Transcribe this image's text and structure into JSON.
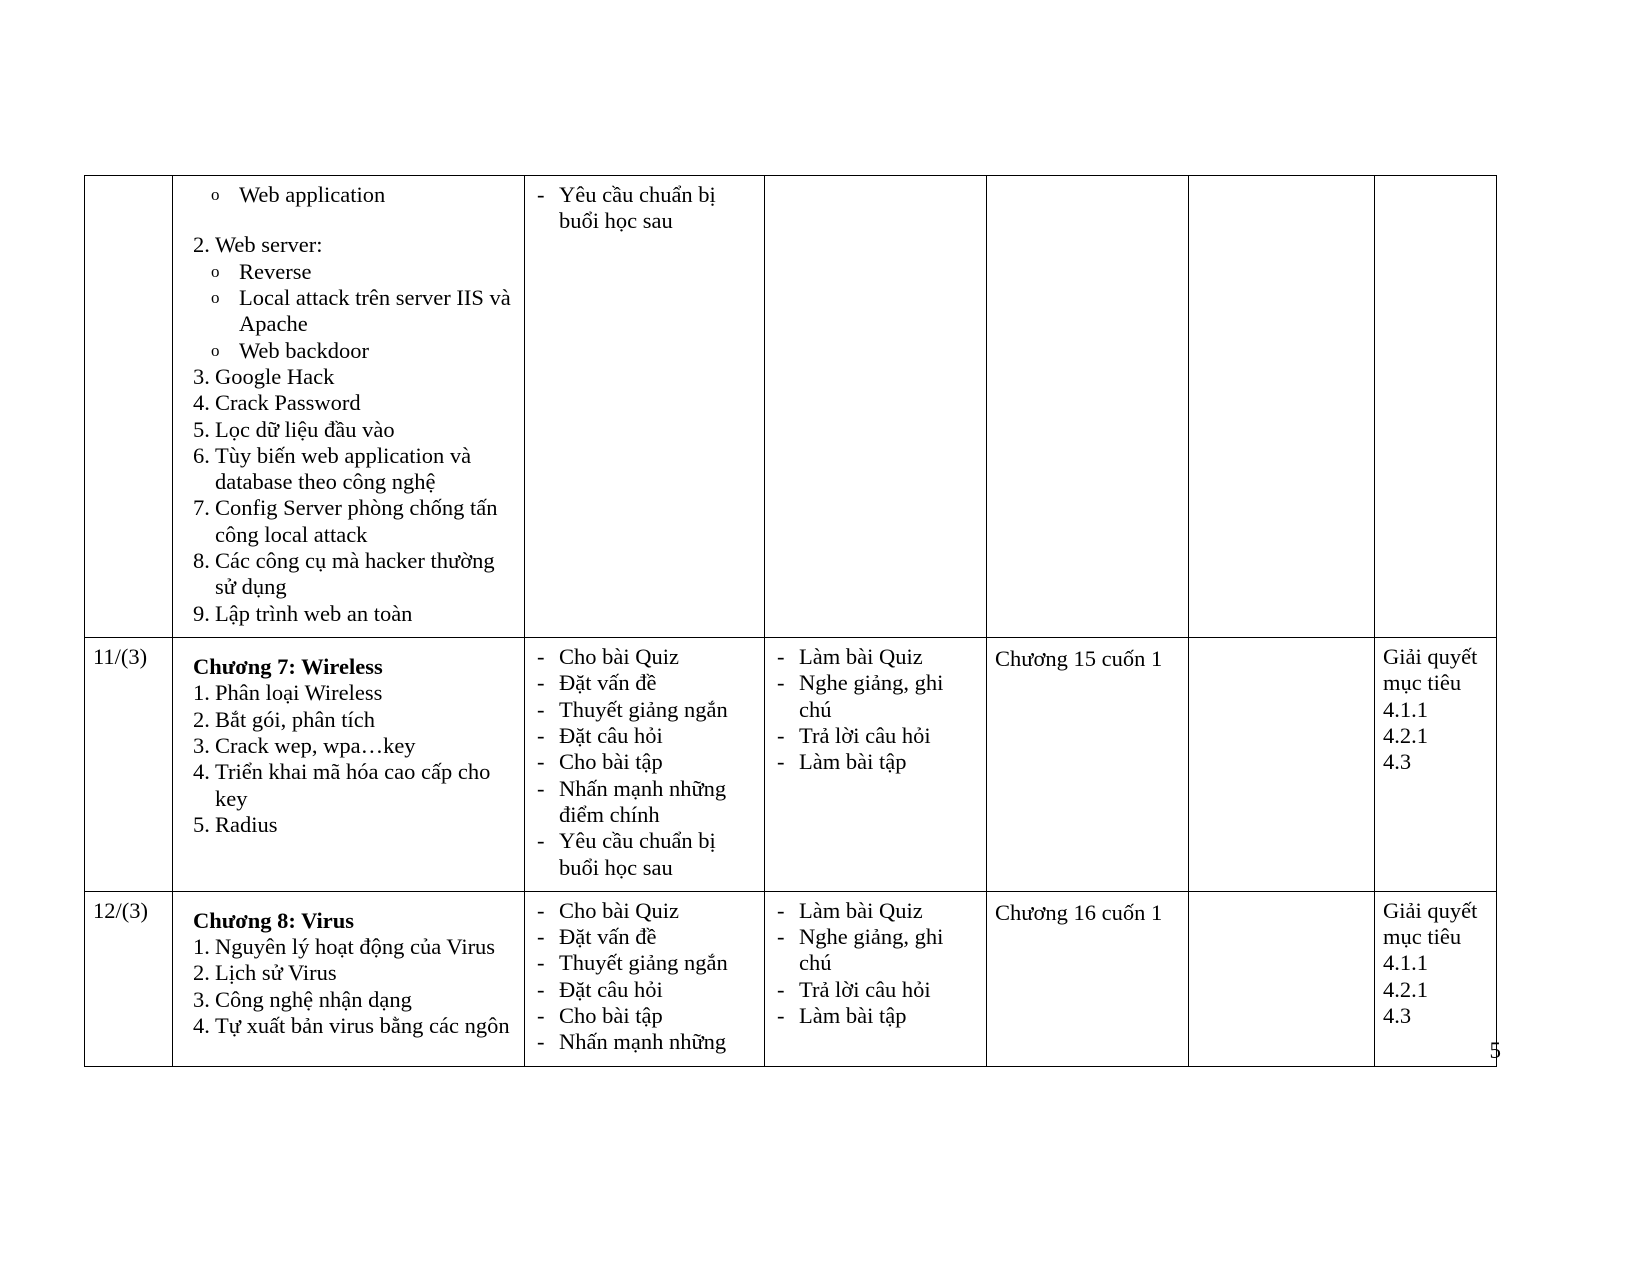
{
  "document": {
    "page_number": "5"
  },
  "table": {
    "rows": [
      {
        "week": "",
        "content": {
          "sub_items_top": [
            "Web application"
          ],
          "section2_label": "2.",
          "section2_title": "Web server:",
          "section2_subitems": [
            "Reverse",
            "Local attack trên server IIS và Apache",
            "Web backdoor"
          ],
          "numbered": [
            {
              "n": "3.",
              "text": "Google Hack"
            },
            {
              "n": "4.",
              "text": "Crack Password"
            },
            {
              "n": "5.",
              "text": "Lọc dữ liệu đầu vào"
            },
            {
              "n": "6.",
              "text": "Tùy biến web application và database theo công nghệ"
            },
            {
              "n": "7.",
              "text": "Config Server phòng chống tấn công local attack"
            },
            {
              "n": "8.",
              "text": "Các công cụ mà hacker thường sử dụng"
            },
            {
              "n": "9.",
              "text": "Lập trình web an toàn"
            }
          ]
        },
        "teaching": [
          "Yêu cầu chuẩn bị buổi học sau"
        ],
        "learning": [],
        "reference": "",
        "extra": "",
        "goal": []
      },
      {
        "week": "11/(3)",
        "content": {
          "chapter": "Chương 7: Wireless",
          "numbered": [
            {
              "n": "1.",
              "text": "Phân loại Wireless"
            },
            {
              "n": "2.",
              "text": "Bắt gói, phân tích"
            },
            {
              "n": "3.",
              "text": "Crack wep, wpa…key"
            },
            {
              "n": "4.",
              "text": "Triển khai mã hóa cao cấp cho key"
            },
            {
              "n": "5.",
              "text": "Radius"
            }
          ]
        },
        "teaching": [
          "Cho bài Quiz",
          "Đặt vấn đề",
          "Thuyết giảng ngắn",
          "Đặt câu hỏi",
          "Cho bài tập",
          "Nhấn mạnh những điểm chính",
          "Yêu cầu chuẩn bị buổi học sau"
        ],
        "learning": [
          "Làm bài Quiz",
          "Nghe giảng, ghi chú",
          "Trả lời câu hỏi",
          "Làm bài tập"
        ],
        "reference": "Chương 15 cuốn 1",
        "extra": "",
        "goal": [
          "Giải quyết",
          "mục tiêu",
          "4.1.1",
          "4.2.1",
          "4.3"
        ]
      },
      {
        "week": "12/(3)",
        "content": {
          "chapter": "Chương 8: Virus",
          "numbered": [
            {
              "n": "1.",
              "text": "Nguyên lý hoạt động của Virus"
            },
            {
              "n": "2.",
              "text": "Lịch sử Virus"
            },
            {
              "n": "3.",
              "text": "Công nghệ nhận dạng"
            },
            {
              "n": "4.",
              "text": "Tự xuất bản virus bằng các ngôn"
            }
          ]
        },
        "teaching": [
          "Cho bài Quiz",
          "Đặt vấn đề",
          "Thuyết giảng ngắn",
          "Đặt câu hỏi",
          "Cho bài tập",
          "Nhấn mạnh những"
        ],
        "learning": [
          "Làm bài Quiz",
          "Nghe giảng, ghi chú",
          "Trả lời câu hỏi",
          "Làm bài tập"
        ],
        "reference": "Chương 16 cuốn 1",
        "extra": "",
        "goal": [
          "Giải quyết",
          "mục tiêu",
          "4.1.1",
          "4.2.1",
          "4.3"
        ]
      }
    ]
  }
}
